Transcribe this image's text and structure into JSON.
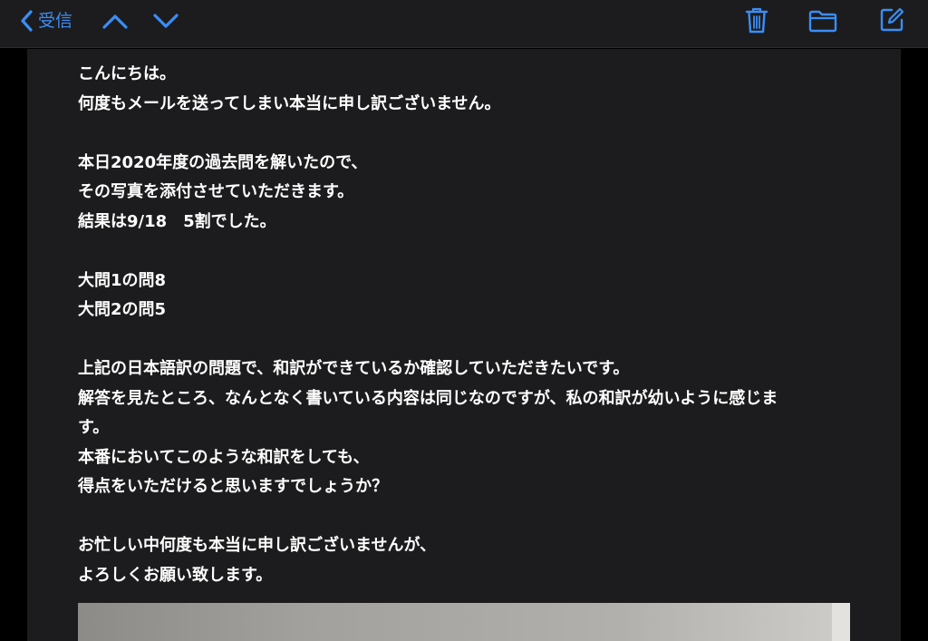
{
  "toolbar": {
    "back_label": "受信",
    "accent_color": "#3a8ef6",
    "icons": [
      "chevron-left-icon",
      "chevron-up-icon",
      "chevron-down-icon",
      "trash-icon",
      "folder-icon",
      "compose-icon"
    ]
  },
  "message": {
    "lines": [
      "こんにちは。",
      "何度もメールを送ってしまい本当に申し訳ございません。",
      "",
      "本日2020年度の過去問を解いたので、",
      "その写真を添付させていただきます。",
      "結果は9/18　5割でした。",
      "",
      "大問1の問8",
      "大問2の問5",
      "",
      "上記の日本語訳の問題で、和訳ができているか確認していただきたいです。",
      "解答を見たところ、なんとなく書いている内容は同じなのですが、私の和訳が幼いように感じま",
      "す。",
      "本番においてこのような和訳をしても、",
      "得点をいただけると思いますでしょうか？",
      "",
      "お忙しい中何度も本当に申し訳ございませんが、",
      "よろしくお願い致します。"
    ]
  }
}
